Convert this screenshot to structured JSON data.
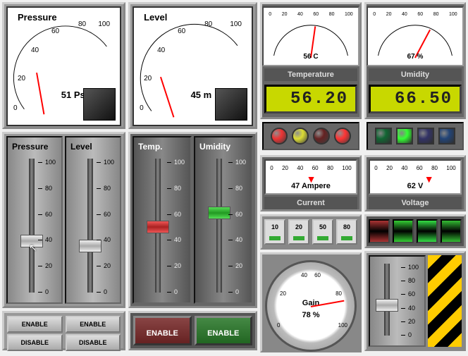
{
  "gauge_pressure": {
    "title": "Pressure",
    "value": 51,
    "unit": "Psi",
    "min": 0,
    "max": 100,
    "ticks": [
      "0",
      "20",
      "40",
      "60",
      "80",
      "100"
    ]
  },
  "gauge_level": {
    "title": "Level",
    "value": 45,
    "unit": "m",
    "min": 0,
    "max": 100,
    "ticks": [
      "0",
      "20",
      "40",
      "60",
      "80",
      "100"
    ]
  },
  "mini_temp": {
    "label": "Temperature",
    "value": 56,
    "unit": "C",
    "ticks": [
      "0",
      "20",
      "40",
      "60",
      "80",
      "100"
    ],
    "lcd": "56.20"
  },
  "mini_humid": {
    "label": "Umidity",
    "value": 67,
    "unit": "%",
    "ticks": [
      "0",
      "20",
      "40",
      "60",
      "80",
      "100"
    ],
    "lcd": "66.50"
  },
  "leds_round": [
    {
      "color": "#e33",
      "name": "red"
    },
    {
      "color": "#dd3",
      "name": "yellow"
    },
    {
      "color": "#722",
      "name": "darkred"
    },
    {
      "color": "#f33",
      "name": "red2"
    }
  ],
  "leds_square": [
    {
      "color": "#163",
      "name": "green-dim"
    },
    {
      "color": "#3f3",
      "name": "green-lit"
    },
    {
      "color": "#336",
      "name": "blue-dim"
    },
    {
      "color": "#247",
      "name": "blue-dim2"
    }
  ],
  "meter_current": {
    "label": "Current",
    "value": 47,
    "unit": "Ampere",
    "ticks": [
      "0",
      "20",
      "40",
      "60",
      "80",
      "100"
    ]
  },
  "meter_voltage": {
    "label": "Voltage",
    "value": 62,
    "unit": "V",
    "ticks": [
      "0",
      "20",
      "40",
      "60",
      "80",
      "100"
    ]
  },
  "switches": [
    {
      "label": "10"
    },
    {
      "label": "20"
    },
    {
      "label": "50"
    },
    {
      "label": "80"
    }
  ],
  "rockers": [
    {
      "color": "#a33"
    },
    {
      "color": "#3a3"
    },
    {
      "color": "#3c4"
    },
    {
      "color": "#3b3"
    }
  ],
  "gain": {
    "label": "Gain",
    "value": 78,
    "unit": "%",
    "ticks": [
      "0",
      "20",
      "40",
      "60",
      "80",
      "100"
    ]
  },
  "slider_pressure": {
    "title": "Pressure",
    "value": 48,
    "scale": [
      "100",
      "80",
      "60",
      "40",
      "20",
      "0"
    ]
  },
  "slider_level": {
    "title": "Level",
    "value": 44,
    "scale": [
      "100",
      "80",
      "60",
      "40",
      "20",
      "0"
    ]
  },
  "slider_temp": {
    "title": "Temp.",
    "value": 58,
    "knob_color": "#b22",
    "scale": [
      "100",
      "80",
      "60",
      "40",
      "20",
      "0"
    ]
  },
  "slider_umid": {
    "title": "Umidity",
    "value": 68,
    "knob_color": "#2a2",
    "scale": [
      "100",
      "80",
      "60",
      "40",
      "20",
      "0"
    ]
  },
  "slider_gain": {
    "value": 50,
    "scale": [
      "100",
      "80",
      "60",
      "40",
      "20",
      "0"
    ]
  },
  "btn": {
    "enable": "ENABLE",
    "disable": "DISABLE"
  }
}
